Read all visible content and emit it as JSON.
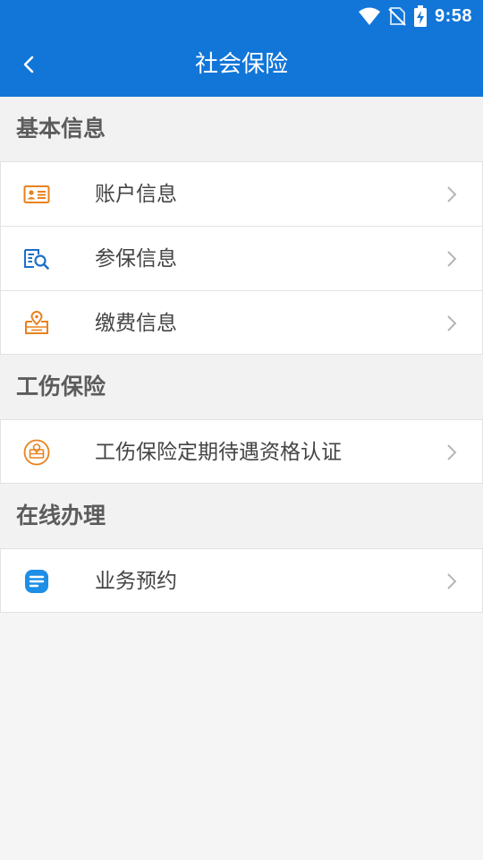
{
  "status_bar": {
    "time": "9:58",
    "icons": [
      "wifi-icon",
      "no-sim-icon",
      "battery-charging-icon"
    ]
  },
  "header": {
    "title": "社会保险",
    "back_icon": "back-arrow-icon",
    "background": "#1176d8"
  },
  "sections": [
    {
      "title": "基本信息",
      "items": [
        {
          "label": "账户信息",
          "icon": "id-card-icon",
          "color": "#e8821e"
        },
        {
          "label": "参保信息",
          "icon": "document-search-icon",
          "color": "#1e6fc8"
        },
        {
          "label": "缴费信息",
          "icon": "payment-location-icon",
          "color": "#e8821e"
        }
      ]
    },
    {
      "title": "工伤保险",
      "items": [
        {
          "label": "工伤保险定期待遇资格认证",
          "icon": "certification-icon",
          "color": "#e8821e"
        }
      ]
    },
    {
      "title": "在线办理",
      "items": [
        {
          "label": "业务预约",
          "icon": "appointment-icon",
          "color": "#1e8fe6"
        }
      ]
    }
  ]
}
